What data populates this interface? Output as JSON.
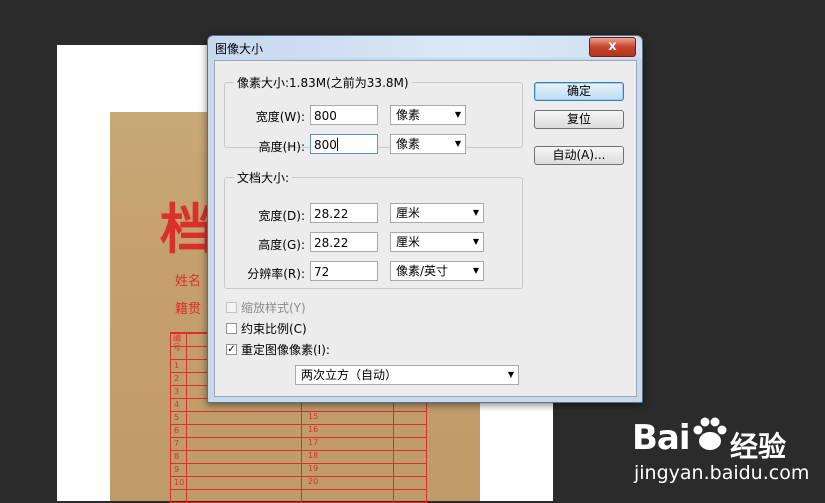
{
  "dialog": {
    "title": "图像大小",
    "close_label": "x",
    "buttons": {
      "ok": "确定",
      "reset": "复位",
      "auto": "自动(A)..."
    },
    "pixel_dimensions": {
      "legend": "像素大小:1.83M(之前为33.8M)",
      "width_label": "宽度(W):",
      "width_value": "800",
      "width_unit": "像素",
      "height_label": "高度(H):",
      "height_value": "800",
      "height_unit": "像素"
    },
    "document_size": {
      "legend": "文档大小:",
      "width_label": "宽度(D):",
      "width_value": "28.22",
      "width_unit": "厘米",
      "height_label": "高度(G):",
      "height_value": "28.22",
      "height_unit": "厘米",
      "resolution_label": "分辨率(R):",
      "resolution_value": "72",
      "resolution_unit": "像素/英寸"
    },
    "options": {
      "scale_styles": {
        "label": "缩放样式(Y)",
        "checked": false,
        "enabled": false
      },
      "constrain_proportions": {
        "label": "约束比例(C)",
        "checked": false,
        "enabled": true
      },
      "resample_image": {
        "label": "重定图像像素(I):",
        "checked": true,
        "enabled": true
      },
      "resample_method": "两次立方（自动）"
    }
  },
  "background_document": {
    "big_character": "档",
    "label_name": "姓名",
    "label_origin": "籍贯",
    "header_cell": "编号",
    "row_numbers": [
      "1",
      "2",
      "3",
      "4",
      "5",
      "6",
      "7",
      "8",
      "9",
      "10"
    ],
    "row_numbers_right": [
      "15",
      "16",
      "17",
      "18",
      "19",
      "20"
    ]
  },
  "watermark": {
    "brand_left": "Bai",
    "brand_right": "经验",
    "url": "jingyan.baidu.com"
  },
  "colors": {
    "background": "#2b2b2b",
    "kraft": "#c4a06d",
    "stamp_red": "#d9302c",
    "dialog_frame": "#c8d9ec",
    "close_red": "#c7452c"
  }
}
